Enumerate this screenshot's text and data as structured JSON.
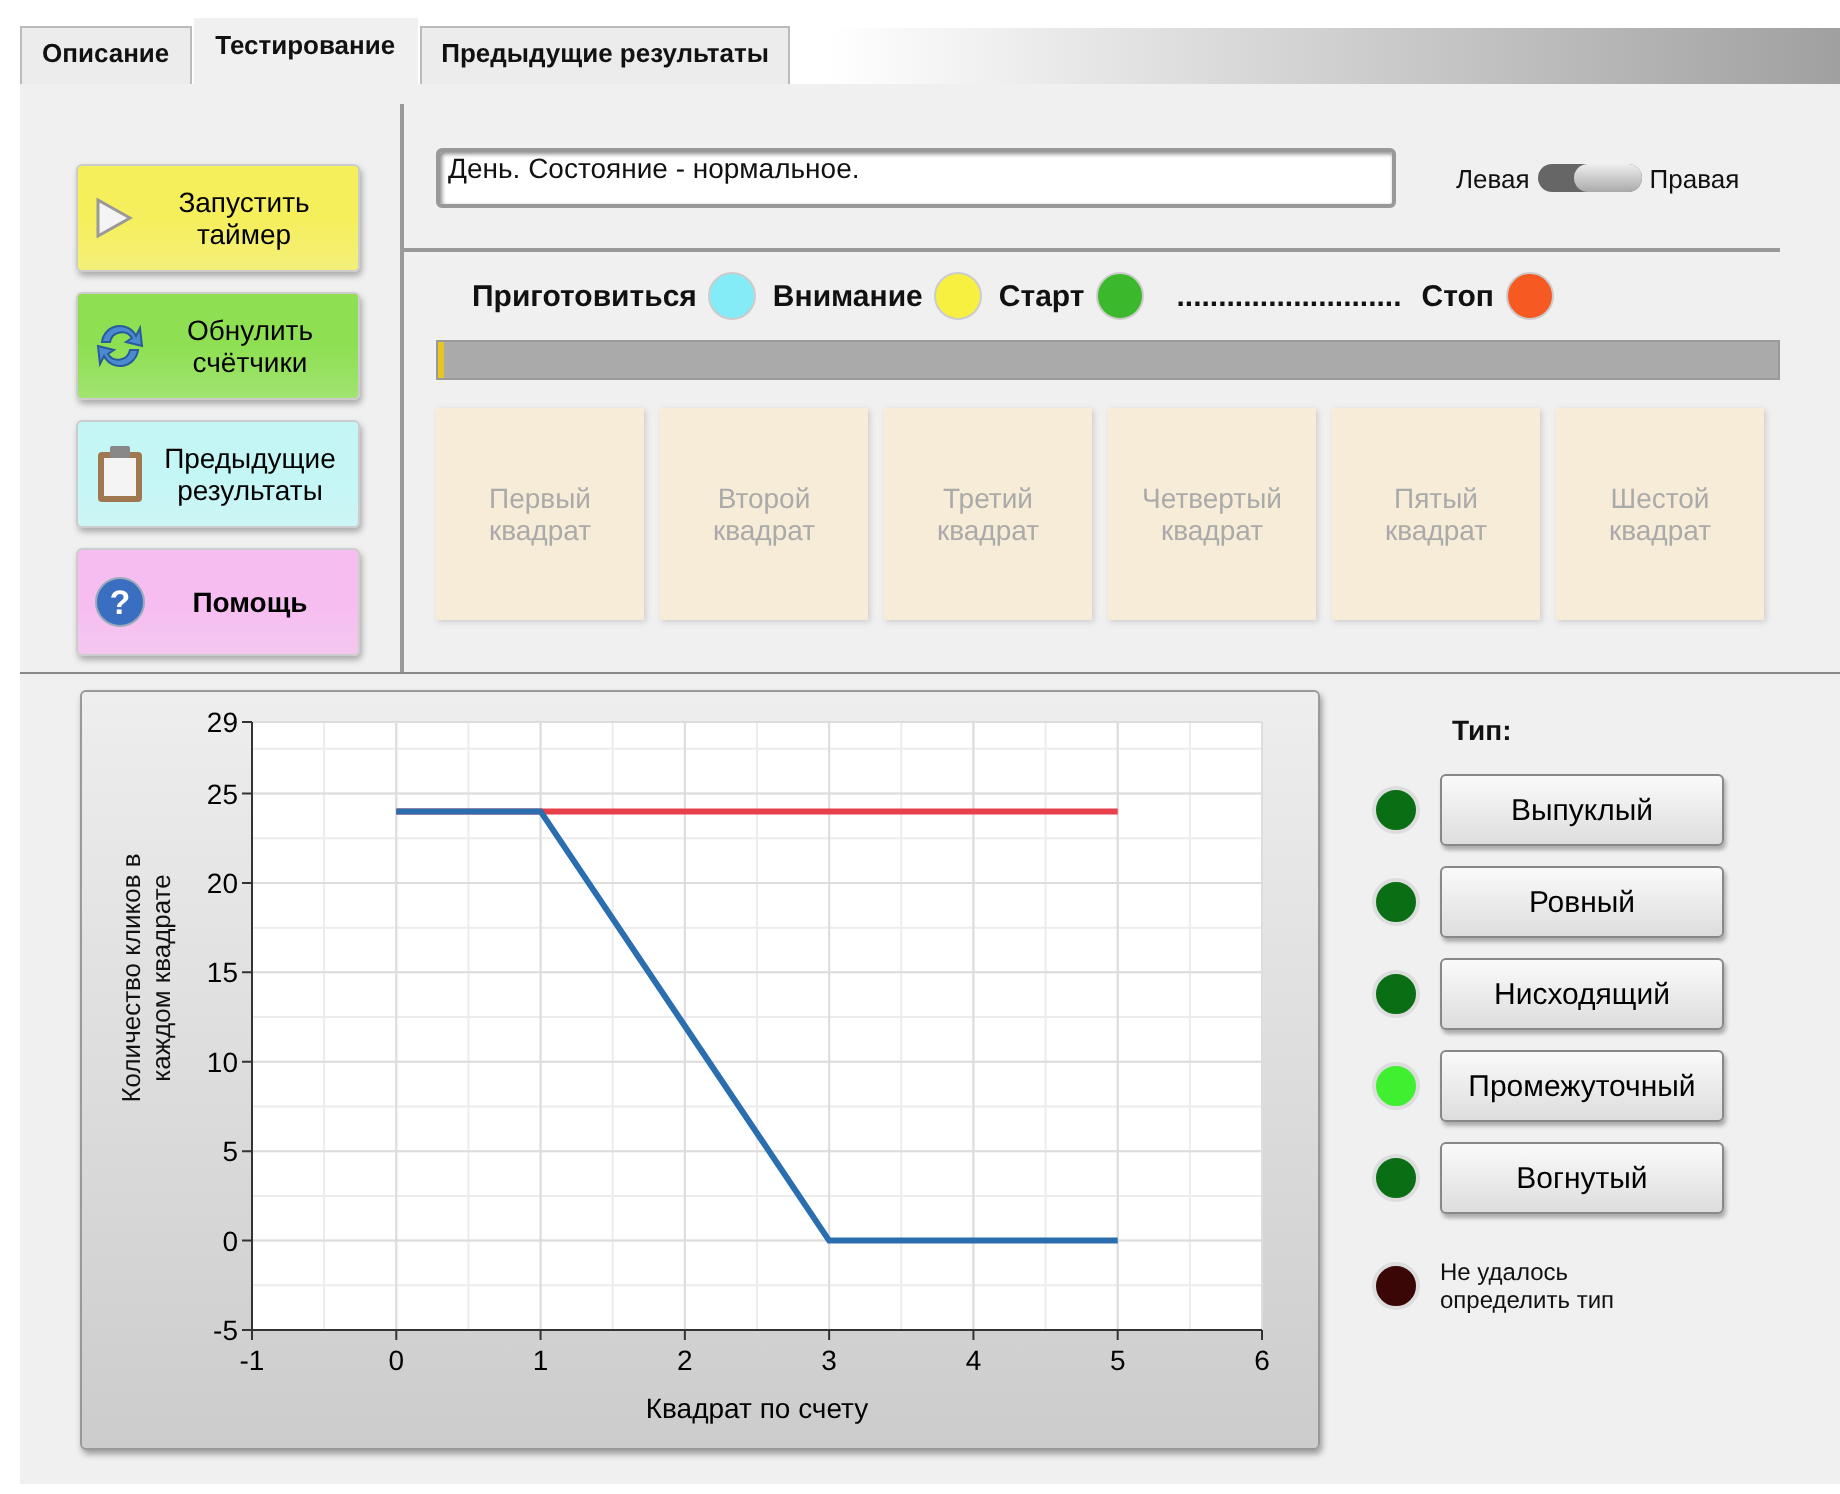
{
  "tabs": [
    {
      "label": "Описание",
      "selected": false
    },
    {
      "label": "Тестирование",
      "selected": true
    },
    {
      "label": "Предыдущие результаты",
      "selected": false
    }
  ],
  "actions": [
    {
      "label": "Запустить таймер",
      "color": "#f5ef5c"
    },
    {
      "label": "Обнулить счётчики",
      "color": "#8ee052"
    },
    {
      "label": "Предыдущие результаты",
      "color": "#c4f6f6"
    },
    {
      "label": "Помощь",
      "color": "#f6bdf0",
      "glyph": "?"
    }
  ],
  "status_field": {
    "value": "День. Состояние - нормальное."
  },
  "hand_switch": {
    "left_label": "Левая",
    "right_label": "Правая",
    "on": true
  },
  "signals": [
    {
      "kind": "light",
      "label": "Приготовиться",
      "color": "#84ecf6"
    },
    {
      "kind": "light",
      "label": "Внимание",
      "color": "#f8f040"
    },
    {
      "kind": "light",
      "label": "Старт",
      "color": "#3cb82c"
    },
    {
      "kind": "dots",
      "label": "..........................."
    },
    {
      "kind": "light",
      "label": "Стоп",
      "color": "#f65a22"
    }
  ],
  "progress": {
    "level": 0.005
  },
  "squares": [
    {
      "label": "Первый квадрат",
      "disabled": true
    },
    {
      "label": "Второй квадрат",
      "disabled": true
    },
    {
      "label": "Третий квадрат",
      "disabled": true
    },
    {
      "label": "Четвертый квадрат",
      "disabled": true
    },
    {
      "label": "Пятый квадрат",
      "disabled": true
    },
    {
      "label": "Шестой квадрат",
      "disabled": true
    }
  ],
  "chart": {
    "chart_data": {
      "type": "line",
      "xlabel": "Квадрат по счету",
      "ylabel": "Количество кликов в каждом квадрате",
      "x": [
        0,
        1,
        2,
        3,
        4,
        5
      ],
      "series": [
        {
          "color": "#e8404a",
          "values": [
            24,
            24,
            24,
            24,
            24,
            24
          ]
        },
        {
          "color": "#2a6eb0",
          "values": [
            24,
            24,
            12,
            0,
            0,
            0
          ]
        }
      ],
      "xlim": [
        -1,
        6
      ],
      "ylim": [
        -5,
        29
      ],
      "xticks": [
        -1,
        0,
        1,
        2,
        3,
        4,
        5,
        6
      ],
      "yticks": [
        -5,
        0,
        5,
        10,
        15,
        20,
        25,
        29
      ],
      "grid": true
    }
  },
  "type_panel": {
    "title": "Тип:",
    "options": [
      {
        "label": "Выпуклый",
        "on": false
      },
      {
        "label": "Ровный",
        "on": false
      },
      {
        "label": "Нисходящий",
        "on": false
      },
      {
        "label": "Промежуточный",
        "on": true
      },
      {
        "label": "Вогнутый",
        "on": false
      }
    ],
    "undetermined": {
      "label": "Не удалось определить тип",
      "on": false
    }
  }
}
